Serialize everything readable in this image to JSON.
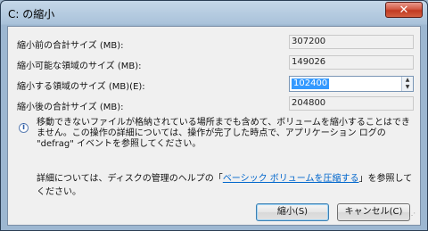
{
  "window": {
    "title": "C: の縮小",
    "close_glyph": "✕"
  },
  "fields": [
    {
      "label": "縮小前の合計サイズ (MB):",
      "value": "307200"
    },
    {
      "label": "縮小可能な領域のサイズ (MB):",
      "value": "149026"
    },
    {
      "label": "縮小する領域のサイズ (MB)(E):",
      "value": "102400"
    },
    {
      "label": "縮小後の合計サイズ (MB):",
      "value": "204800"
    }
  ],
  "info": {
    "icon": "info-icon",
    "text": "移動できないファイルが格納されている場所までも含めて、ボリュームを縮小することはできません。この操作の詳細については、操作が完了した時点で、アプリケーション ログの \"defrag\" イベントを参照してください。"
  },
  "help": {
    "prefix": "詳細については、ディスクの管理のヘルプの「",
    "link": "ベーシック ボリュームを圧縮する",
    "suffix": "」を参照してください。"
  },
  "buttons": {
    "shrink": "縮小(S)",
    "cancel": "キャンセル(C)"
  }
}
